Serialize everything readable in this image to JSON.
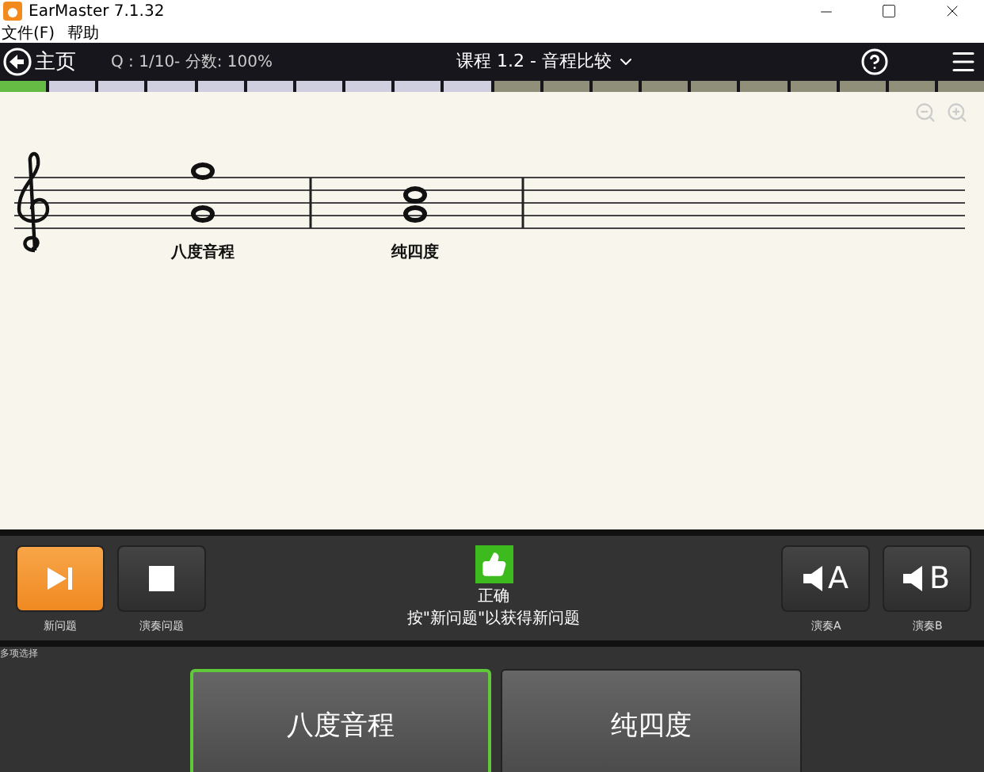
{
  "window": {
    "title": "EarMaster 7.1.32"
  },
  "menu": [
    "文件(F)",
    "帮助"
  ],
  "header": {
    "home": "主页",
    "score": "Q : 1/10- 分数: 100%",
    "lesson": "课程 1.2 - 音程比较"
  },
  "progress": [
    {
      "kind": "done"
    },
    {
      "kind": "todo"
    },
    {
      "kind": "todo"
    },
    {
      "kind": "todo"
    },
    {
      "kind": "todo"
    },
    {
      "kind": "todo"
    },
    {
      "kind": "todo"
    },
    {
      "kind": "todo"
    },
    {
      "kind": "todo"
    },
    {
      "kind": "todo"
    },
    {
      "kind": "off"
    },
    {
      "kind": "off"
    },
    {
      "kind": "off"
    },
    {
      "kind": "off"
    },
    {
      "kind": "off"
    },
    {
      "kind": "off"
    },
    {
      "kind": "off"
    },
    {
      "kind": "off"
    },
    {
      "kind": "off"
    },
    {
      "kind": "off"
    }
  ],
  "score_labels": [
    "八度音程",
    "纯四度"
  ],
  "controls": {
    "left": [
      {
        "kind": "next",
        "label": "新问题",
        "highlighted": true
      },
      {
        "kind": "stop",
        "label": "演奏问题",
        "highlighted": false
      }
    ],
    "status": "正确",
    "hint": "按\"新问题\"以获得新问题",
    "right": [
      {
        "letter": "A",
        "label": "演奏A"
      },
      {
        "letter": "B",
        "label": "演奏B"
      }
    ]
  },
  "answers": {
    "title": "多项选择",
    "options": [
      {
        "label": "八度音程",
        "selected": true
      },
      {
        "label": "纯四度",
        "selected": false
      }
    ]
  }
}
